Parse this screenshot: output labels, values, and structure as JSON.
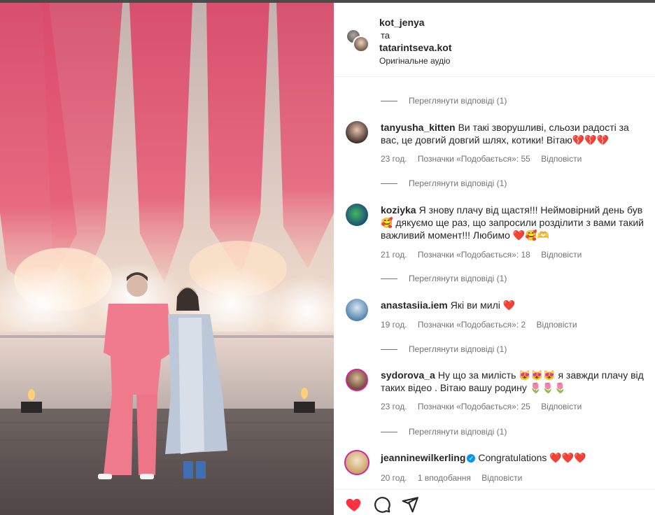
{
  "post": {
    "author_1": "kot_jenya",
    "and_text": "та",
    "author_2": "tatarintseva.kot",
    "audio": "Оригінальне аудіо"
  },
  "view_replies": [
    "Переглянути відповіді (1)",
    "Переглянути відповіді (1)",
    "Переглянути відповіді (1)",
    "Переглянути відповіді (1)",
    "Переглянути відповіді (1)"
  ],
  "comments": [
    {
      "username": "tanyusha_kitten",
      "text": "Ви такі зворушливі, сльози радості за вас, це довгий довгий шлях, котики! Вітаю💔💔💔",
      "time": "23 год.",
      "likes": "Позначки «Подобається»: 55",
      "reply": "Відповісти"
    },
    {
      "username": "koziyka",
      "text": "Я знову плачу від щастя!!! Неймовірний день був 🥰 дякуємо ще раз, що запросили розділити з вами такий важливий момент!!! Любимо ❤️🥰🫶",
      "time": "21 год.",
      "likes": "Позначки «Подобається»: 18",
      "reply": "Відповісти"
    },
    {
      "username": "anastasiia.iem",
      "text": "Які ви милі ❤️",
      "time": "19 год.",
      "likes": "Позначки «Подобається»: 2",
      "reply": "Відповісти"
    },
    {
      "username": "sydorova_a",
      "text": "Ну що за милість 😻😻😻 я завжди плачу від таких відео . Вітаю вашу родину 🌷🌷🌷",
      "time": "23 год.",
      "likes": "Позначки «Подобається»: 25",
      "reply": "Відповісти"
    },
    {
      "username": "jeanninewilkerling",
      "text": "Congratulations ❤️❤️❤️",
      "time": "20 год.",
      "likes": "1 вподобання",
      "reply": "Відповісти"
    }
  ],
  "icons": {
    "like": "heart-icon",
    "comment": "comment-icon",
    "share": "share-icon"
  },
  "colors": {
    "like_red": "#ff3040",
    "muted": "#737373"
  }
}
